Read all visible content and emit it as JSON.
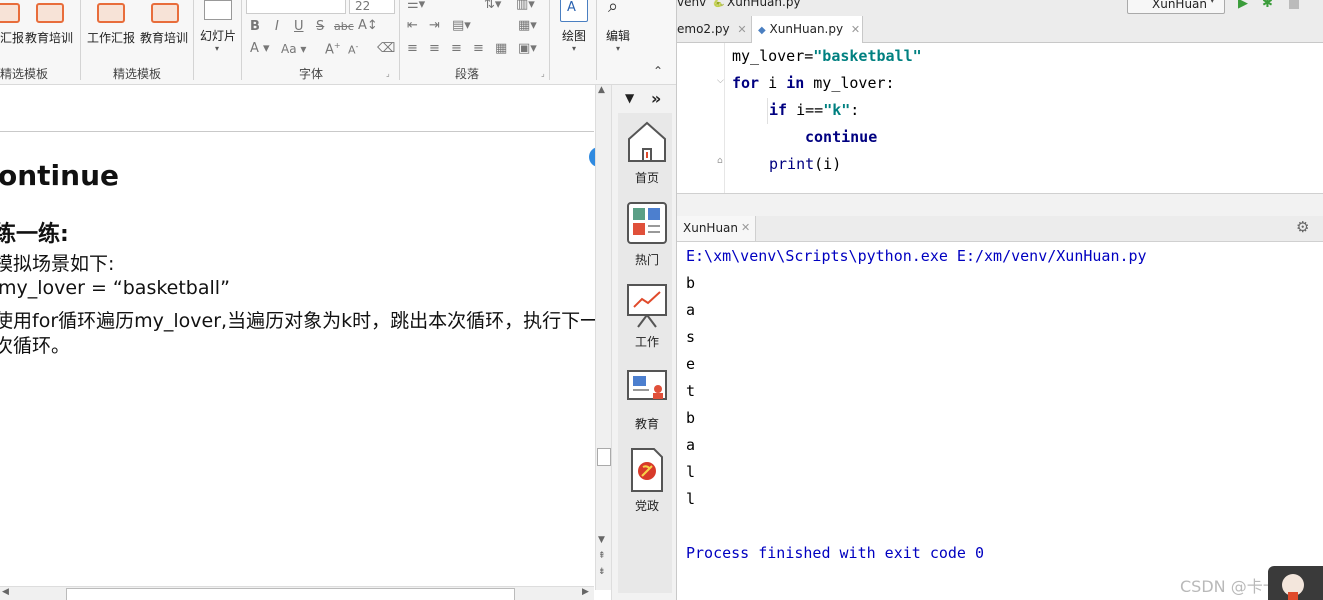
{
  "word": {
    "ribbon": {
      "btn_report": "汇报",
      "btn_edu": "教育培训",
      "btn_work_report": "工作汇报",
      "btn_edu2": "教育培训",
      "btn_slides": "幻灯片",
      "group_templates_1": "精选模板",
      "group_templates_2": "精选模板",
      "group_font": "字体",
      "group_paragraph": "段落",
      "font_size": "22",
      "fmt_bold": "B",
      "fmt_italic": "I",
      "fmt_underline": "U",
      "fmt_strike": "S",
      "fmt_abc": "abc",
      "btn_draw": "绘图",
      "btn_edit": "编辑"
    },
    "doc": {
      "heading": "ontinue",
      "subheading": "练一练:",
      "line1": "模拟场景如下:",
      "line2": "my_lover =  “basketball”",
      "line3": "使用for循环遍历my_lover,当遍历对象为k时，跳出本次循环，执行下一",
      "line4": "次循环。"
    },
    "sidepanel": {
      "items": [
        {
          "label": "首页",
          "icon": "home-icon"
        },
        {
          "label": "热门",
          "icon": "grid-icon"
        },
        {
          "label": "工作",
          "icon": "chart-board-icon"
        },
        {
          "label": "教育",
          "icon": "presentation-icon"
        },
        {
          "label": "党政",
          "icon": "party-icon"
        }
      ]
    }
  },
  "ide": {
    "top_left": "venv",
    "top_file": "XunHuan.py",
    "run_config": "XunHuan",
    "tabs": [
      {
        "label": "emo2.py"
      },
      {
        "label": "XunHuan.py"
      }
    ],
    "code": {
      "l1_var": "my_lover=",
      "l1_str": "\"basketball\"",
      "l2_for": "for",
      "l2_mid": " i ",
      "l2_in": "in",
      "l2_rest": " my_lover:",
      "l3_if": "if",
      "l3_mid": " i==",
      "l3_str": "\"k\"",
      "l3_colon": ":",
      "l4_continue": "continue",
      "l5_print": "print",
      "l5_args": "(i)"
    },
    "run_tab": "XunHuan",
    "console": {
      "command": "E:\\xm\\venv\\Scripts\\python.exe E:/xm/venv/XunHuan.py",
      "lines": [
        "b",
        "a",
        "s",
        "e",
        "t",
        "b",
        "a",
        "l",
        "l"
      ],
      "finish": "Process finished with exit code 0"
    },
    "watermark": "CSDN @卡卡@"
  },
  "colors": {
    "keyword": "#000080",
    "string": "#008080",
    "console_text": "#0000c0",
    "accent_orange": "#e86d3b"
  }
}
